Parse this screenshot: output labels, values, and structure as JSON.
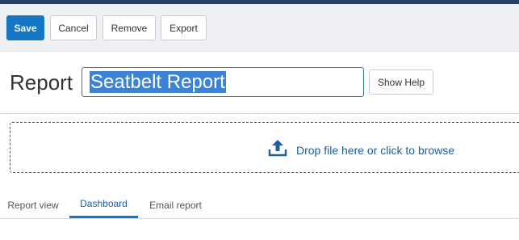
{
  "toolbar": {
    "save_label": "Save",
    "cancel_label": "Cancel",
    "remove_label": "Remove",
    "export_label": "Export"
  },
  "header": {
    "title_label": "Report",
    "title_value": "Seatbelt Report",
    "help_label": "Show Help"
  },
  "dropzone": {
    "icon": "upload-icon",
    "text": "Drop file here or click to browse"
  },
  "tabs": [
    {
      "label": "Report view",
      "active": false
    },
    {
      "label": "Dashboard",
      "active": true
    },
    {
      "label": "Email report",
      "active": false
    }
  ],
  "colors": {
    "primary": "#1676c6",
    "link": "#1a5fa0",
    "topbar": "#2b3f63",
    "selection": "#3a83d6"
  }
}
